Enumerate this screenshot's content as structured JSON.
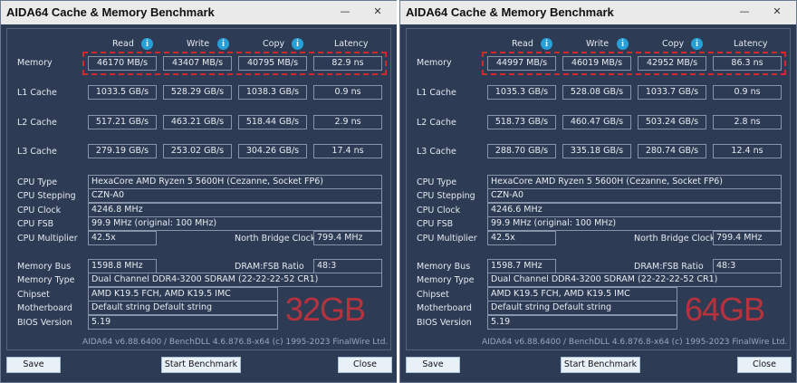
{
  "left": {
    "title": "AIDA64 Cache & Memory Benchmark",
    "headers": {
      "read": "Read",
      "write": "Write",
      "copy": "Copy",
      "latency": "Latency"
    },
    "rows": [
      {
        "label": "Memory",
        "read": "46170 MB/s",
        "write": "43407 MB/s",
        "copy": "40795 MB/s",
        "latency": "82.9 ns"
      },
      {
        "label": "L1 Cache",
        "read": "1033.5 GB/s",
        "write": "528.29 GB/s",
        "copy": "1038.3 GB/s",
        "latency": "0.9 ns"
      },
      {
        "label": "L2 Cache",
        "read": "517.21 GB/s",
        "write": "463.21 GB/s",
        "copy": "518.44 GB/s",
        "latency": "2.9 ns"
      },
      {
        "label": "L3 Cache",
        "read": "279.19 GB/s",
        "write": "253.02 GB/s",
        "copy": "304.26 GB/s",
        "latency": "17.4 ns"
      }
    ],
    "cpu_type_label": "CPU Type",
    "cpu_type": "HexaCore AMD Ryzen 5 5600H  (Cezanne, Socket FP6)",
    "cpu_stepping_label": "CPU Stepping",
    "cpu_stepping": "CZN-A0",
    "cpu_clock_label": "CPU Clock",
    "cpu_clock": "4246.8 MHz",
    "cpu_fsb_label": "CPU FSB",
    "cpu_fsb": "99.9 MHz  (original: 100 MHz)",
    "cpu_mult_label": "CPU Multiplier",
    "cpu_mult": "42.5x",
    "nb_clock_label": "North Bridge Clock",
    "nb_clock": "799.4 MHz",
    "mem_bus_label": "Memory Bus",
    "mem_bus": "1598.8 MHz",
    "dram_ratio_label": "DRAM:FSB Ratio",
    "dram_ratio": "48:3",
    "mem_type_label": "Memory Type",
    "mem_type": "Dual Channel DDR4-3200 SDRAM  (22-22-22-52 CR1)",
    "chipset_label": "Chipset",
    "chipset": "AMD K19.5 FCH, AMD K19.5 IMC",
    "motherboard_label": "Motherboard",
    "motherboard": "Default string Default string",
    "bios_label": "BIOS Version",
    "bios": "5.19",
    "overlay": "32GB",
    "footer": "AIDA64 v6.88.6400 / BenchDLL 4.6.876.8-x64  (c) 1995-2023 FinalWire Ltd.",
    "save": "Save",
    "start": "Start Benchmark",
    "close": "Close"
  },
  "right": {
    "title": "AIDA64 Cache & Memory Benchmark",
    "headers": {
      "read": "Read",
      "write": "Write",
      "copy": "Copy",
      "latency": "Latency"
    },
    "rows": [
      {
        "label": "Memory",
        "read": "44997 MB/s",
        "write": "46019 MB/s",
        "copy": "42952 MB/s",
        "latency": "86.3 ns"
      },
      {
        "label": "L1 Cache",
        "read": "1035.3 GB/s",
        "write": "528.08 GB/s",
        "copy": "1033.7 GB/s",
        "latency": "0.9 ns"
      },
      {
        "label": "L2 Cache",
        "read": "518.73 GB/s",
        "write": "460.47 GB/s",
        "copy": "503.24 GB/s",
        "latency": "2.8 ns"
      },
      {
        "label": "L3 Cache",
        "read": "288.70 GB/s",
        "write": "335.18 GB/s",
        "copy": "280.74 GB/s",
        "latency": "12.4 ns"
      }
    ],
    "cpu_type_label": "CPU Type",
    "cpu_type": "HexaCore AMD Ryzen 5 5600H  (Cezanne, Socket FP6)",
    "cpu_stepping_label": "CPU Stepping",
    "cpu_stepping": "CZN-A0",
    "cpu_clock_label": "CPU Clock",
    "cpu_clock": "4246.6 MHz",
    "cpu_fsb_label": "CPU FSB",
    "cpu_fsb": "99.9 MHz  (original: 100 MHz)",
    "cpu_mult_label": "CPU Multiplier",
    "cpu_mult": "42.5x",
    "nb_clock_label": "North Bridge Clock",
    "nb_clock": "799.4 MHz",
    "mem_bus_label": "Memory Bus",
    "mem_bus": "1598.7 MHz",
    "dram_ratio_label": "DRAM:FSB Ratio",
    "dram_ratio": "48:3",
    "mem_type_label": "Memory Type",
    "mem_type": "Dual Channel DDR4-3200 SDRAM  (22-22-22-52 CR1)",
    "chipset_label": "Chipset",
    "chipset": "AMD K19.5 FCH, AMD K19.5 IMC",
    "motherboard_label": "Motherboard",
    "motherboard": "Default string Default string",
    "bios_label": "BIOS Version",
    "bios": "5.19",
    "overlay": "64GB",
    "footer": "AIDA64 v6.88.6400 / BenchDLL 4.6.876.8-x64  (c) 1995-2023 FinalWire Ltd.",
    "save": "Save",
    "start": "Start Benchmark",
    "close": "Close"
  },
  "colors": {
    "window_bg": "#2d3c54",
    "highlight": "#d8262c",
    "overlay_text": "#c7313a",
    "info_icon": "#27a0d8"
  }
}
